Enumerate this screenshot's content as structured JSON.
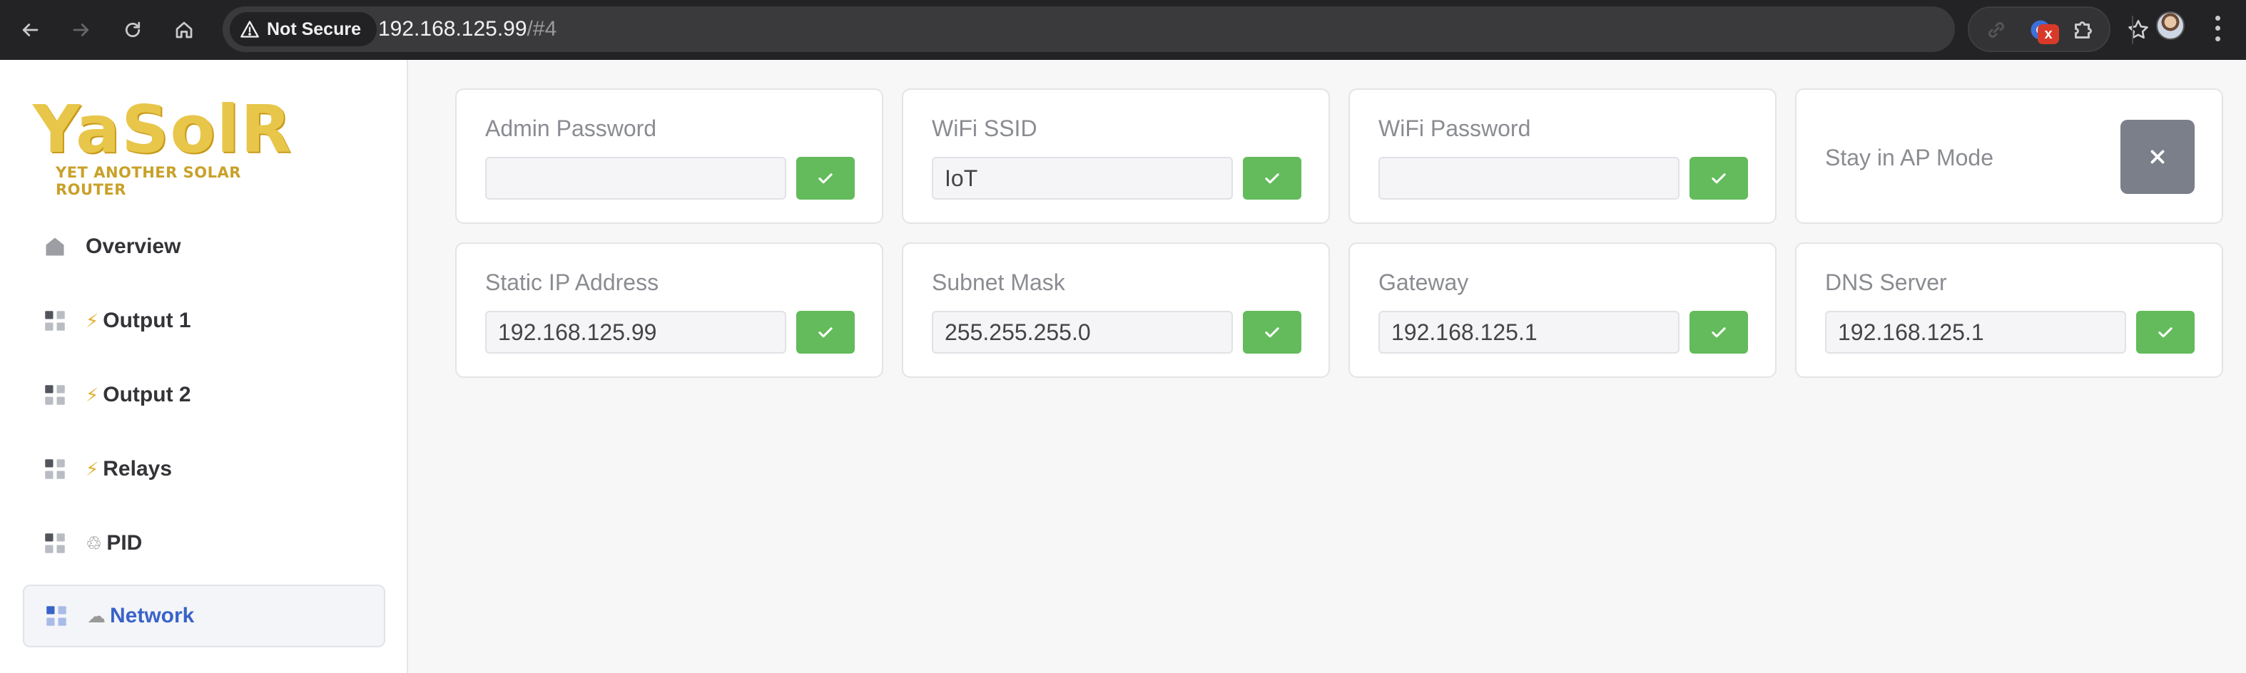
{
  "browser": {
    "security_label": "Not Secure",
    "url_host": "192.168.125.99",
    "url_rest": "/#4",
    "extension_badge": "x",
    "icons": [
      "back-icon",
      "forward-icon",
      "reload-icon",
      "home-icon",
      "warning-icon",
      "star-icon",
      "link-icon",
      "chrome-extension-icon",
      "puzzle-icon",
      "avatar",
      "more-icon"
    ]
  },
  "sidebar": {
    "logo_text": "YaSolR",
    "logo_tagline": "YET ANOTHER SOLAR ROUTER",
    "items": [
      {
        "label": "Overview",
        "prefix": "",
        "icon": "home-icon",
        "active": false
      },
      {
        "label": "Output 1",
        "prefix": "⚡",
        "icon": "grid-icon",
        "active": false
      },
      {
        "label": "Output 2",
        "prefix": "⚡",
        "icon": "grid-icon",
        "active": false
      },
      {
        "label": "Relays",
        "prefix": "⚡",
        "icon": "grid-icon",
        "active": false
      },
      {
        "label": "PID",
        "prefix": "♲",
        "icon": "grid-icon",
        "active": false
      },
      {
        "label": "Network",
        "prefix": "☁",
        "icon": "grid-icon",
        "active": true
      }
    ]
  },
  "cards": {
    "admin_password": {
      "title": "Admin Password",
      "value": ""
    },
    "wifi_ssid": {
      "title": "WiFi SSID",
      "value": "IoT"
    },
    "wifi_password": {
      "title": "WiFi Password",
      "value": ""
    },
    "stay_ap": {
      "title": "Stay in AP Mode",
      "state": "off"
    },
    "static_ip": {
      "title": "Static IP Address",
      "value": "192.168.125.99"
    },
    "subnet_mask": {
      "title": "Subnet Mask",
      "value": "255.255.255.0"
    },
    "gateway": {
      "title": "Gateway",
      "value": "192.168.125.1"
    },
    "dns_server": {
      "title": "DNS Server",
      "value": "192.168.125.1"
    }
  },
  "colors": {
    "accent": "#3a63c9",
    "ok_button": "#63bb5c",
    "off_button": "#7b7f8a",
    "logo": "#e8c64a"
  }
}
